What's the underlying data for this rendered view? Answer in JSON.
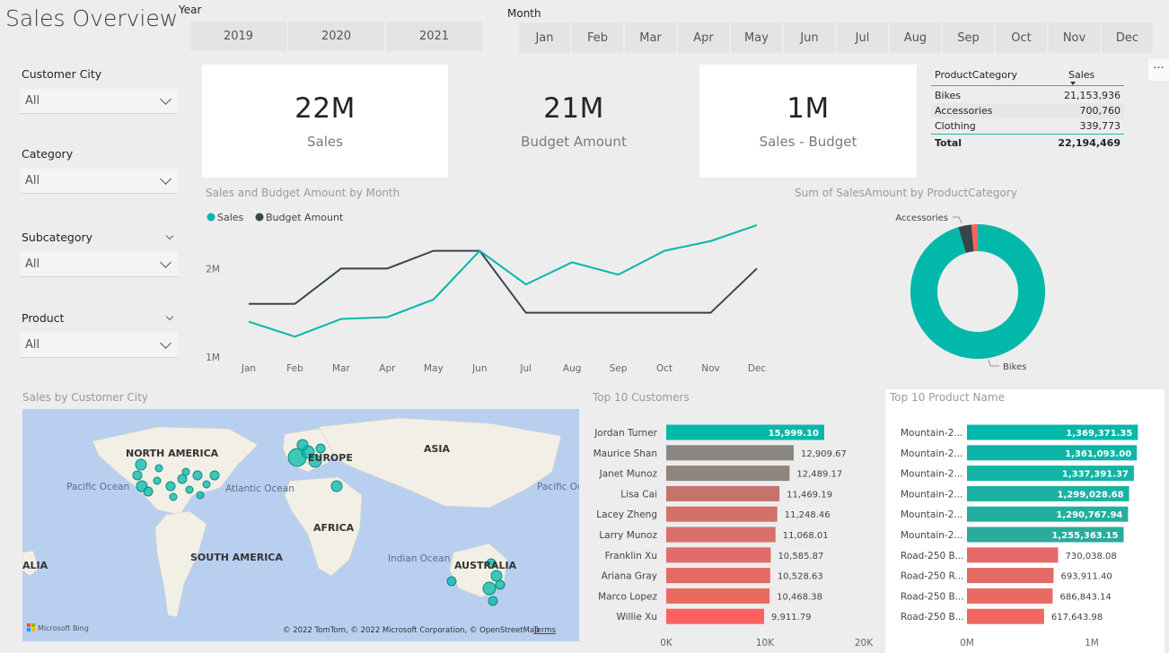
{
  "header": {
    "title": "Sales Overview",
    "year_label": "Year",
    "years": [
      "2019",
      "2020",
      "2021"
    ],
    "month_label": "Month",
    "months": [
      "Jan",
      "Feb",
      "Mar",
      "Apr",
      "May",
      "Jun",
      "Jul",
      "Aug",
      "Sep",
      "Oct",
      "Nov",
      "Dec"
    ]
  },
  "slicers": [
    {
      "label": "Customer City",
      "value": "All"
    },
    {
      "label": "Category",
      "value": "All"
    },
    {
      "label": "Subcategory",
      "value": "All"
    },
    {
      "label": "Product",
      "value": "All"
    }
  ],
  "kpis": [
    {
      "value": "22M",
      "label": "Sales"
    },
    {
      "value": "21M",
      "label": "Budget Amount"
    },
    {
      "value": "1M",
      "label": "Sales - Budget"
    }
  ],
  "category_table": {
    "headers": [
      "ProductCategory",
      "Sales"
    ],
    "rows": [
      {
        "name": "Bikes",
        "value": "21,153,936"
      },
      {
        "name": "Accessories",
        "value": "700,760"
      },
      {
        "name": "Clothing",
        "value": "339,773"
      }
    ],
    "total": {
      "name": "Total",
      "value": "22,194,469"
    }
  },
  "more_options_glyph": "···",
  "map": {
    "title": "Sales by Customer City",
    "labels": [
      "NORTH AMERICA",
      "EUROPE",
      "ASIA",
      "Pacific Ocean",
      "Atlantic Ocean",
      "Pacific Ocean",
      "AFRICA",
      "SOUTH AMERICA",
      "Indian Ocean",
      "AUSTRALIA",
      "ALIA"
    ],
    "attribution": "© 2022 TomTom, © 2022 Microsoft Corporation, © OpenStreetMap",
    "terms": "Terms",
    "logo_text": "Microsoft Bing"
  },
  "colors": {
    "teal": "#01b8aa",
    "dark": "#374649",
    "gray": "#8a8780",
    "salmon": "#c6736b",
    "red": "#fd625e"
  },
  "chart_data": [
    {
      "type": "line",
      "title": "Sales and Budget Amount by Month",
      "x": [
        "Jan",
        "Feb",
        "Mar",
        "Apr",
        "May",
        "Jun",
        "Jul",
        "Aug",
        "Sep",
        "Oct",
        "Nov",
        "Dec"
      ],
      "yticks": [
        "1M",
        "2M"
      ],
      "ylim": [
        1000000,
        2500000
      ],
      "legend": "top-left",
      "series": [
        {
          "name": "Sales",
          "color": "#01b8aa",
          "values": [
            1400000,
            1230000,
            1430000,
            1450000,
            1650000,
            2200000,
            1820000,
            2070000,
            1930000,
            2200000,
            2310000,
            2490000
          ]
        },
        {
          "name": "Budget Amount",
          "color": "#374649",
          "values": [
            1600000,
            1600000,
            2000000,
            2000000,
            2200000,
            2200000,
            1500000,
            1500000,
            1500000,
            1500000,
            1500000,
            2000000
          ]
        }
      ]
    },
    {
      "type": "pie",
      "title": "Sum of SalesAmount by ProductCategory",
      "labels": [
        "Bikes",
        "Accessories",
        "Clothing"
      ],
      "values": [
        21153936,
        700760,
        339773
      ],
      "colors": [
        "#01b8aa",
        "#374649",
        "#fd625e"
      ],
      "shown_labels": [
        "Accessories",
        "Bikes"
      ]
    },
    {
      "type": "bar",
      "title": "Top 10 Customers",
      "categories": [
        "Jordan Turner",
        "Maurice Shan",
        "Janet Munoz",
        "Lisa Cai",
        "Lacey Zheng",
        "Larry Munoz",
        "Franklin Xu",
        "Ariana Gray",
        "Marco Lopez",
        "Willie Xu"
      ],
      "values": [
        15999.1,
        12909.67,
        12489.17,
        11469.19,
        11248.46,
        11068.01,
        10585.87,
        10528.63,
        10468.38,
        9911.79
      ],
      "labels": [
        "15,999.10",
        "12,909.67",
        "12,489.17",
        "11,469.19",
        "11,248.46",
        "11,068.01",
        "10,585.87",
        "10,528.63",
        "10,468.38",
        "9,911.79"
      ],
      "colors": [
        "#01b8aa",
        "#8a8780",
        "#8f857c",
        "#c6736b",
        "#d2706a",
        "#d87069",
        "#e06d67",
        "#e56b64",
        "#ec6962",
        "#fd625e"
      ],
      "xticks": [
        "0K",
        "10K",
        "20K"
      ],
      "xlim": [
        0,
        20000
      ]
    },
    {
      "type": "bar",
      "title": "Top 10 Product Name",
      "categories": [
        "Mountain-2...",
        "Mountain-2...",
        "Mountain-2...",
        "Mountain-2...",
        "Mountain-2...",
        "Mountain-2...",
        "Road-250 B...",
        "Road-250 R...",
        "Road-250 B...",
        "Road-250 B..."
      ],
      "values": [
        1369371.35,
        1361093.0,
        1337391.37,
        1299028.68,
        1290767.94,
        1255363.15,
        730038.08,
        693911.4,
        686843.14,
        617643.98
      ],
      "labels": [
        "1,369,371.35",
        "1,361,093.00",
        "1,337,391.37",
        "1,299,028.68",
        "1,290,767.94",
        "1,255,363.15",
        "730,038.08",
        "693,911.40",
        "686,843.14",
        "617,643.98"
      ],
      "colors": [
        "#01b8aa",
        "#0bb6a8",
        "#13b4a6",
        "#1cb1a3",
        "#24aea0",
        "#2aab9e",
        "#e36a66",
        "#e66a65",
        "#ea6963",
        "#f06761"
      ],
      "xticks": [
        "0M",
        "1M"
      ],
      "xlim": [
        0,
        1000000
      ]
    }
  ]
}
